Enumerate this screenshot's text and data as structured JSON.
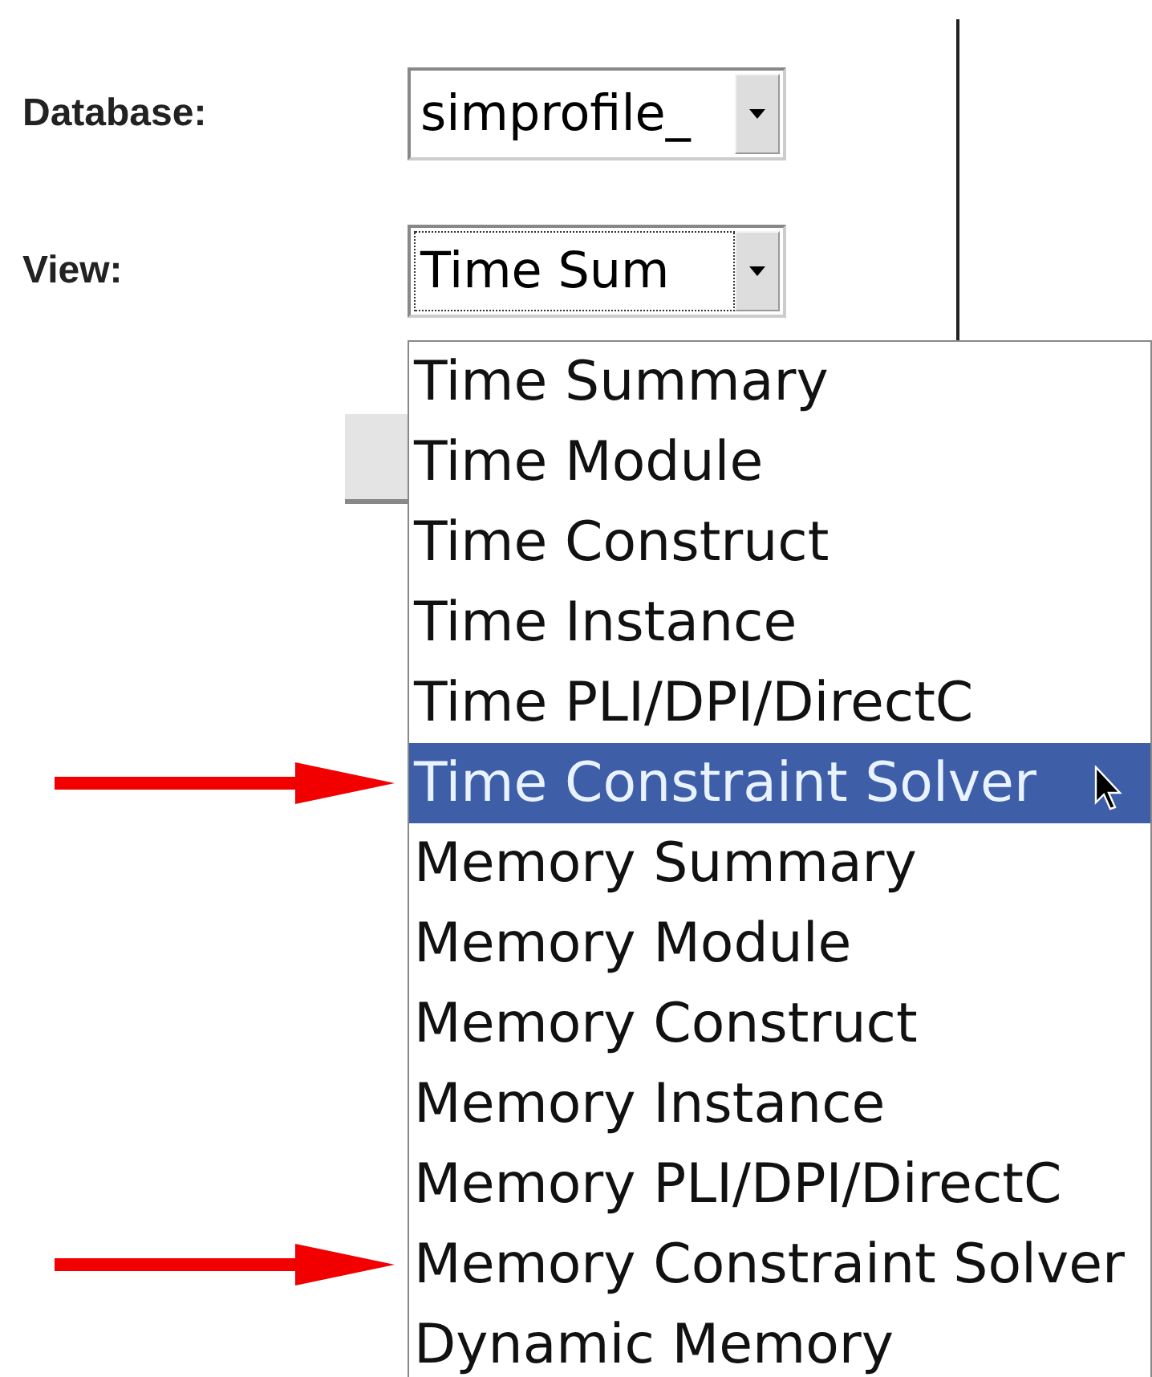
{
  "form": {
    "database_label": "Database:",
    "database_value": "simprofile_",
    "view_label": "View:",
    "view_value": "Time Sum"
  },
  "view_options": [
    {
      "label": "Time Summary",
      "selected": false,
      "annotated": false
    },
    {
      "label": "Time Module",
      "selected": false,
      "annotated": false
    },
    {
      "label": "Time Construct",
      "selected": false,
      "annotated": false
    },
    {
      "label": "Time Instance",
      "selected": false,
      "annotated": false
    },
    {
      "label": "Time PLI/DPI/DirectC",
      "selected": false,
      "annotated": false
    },
    {
      "label": "Time Constraint Solver",
      "selected": true,
      "annotated": true
    },
    {
      "label": "Memory Summary",
      "selected": false,
      "annotated": false
    },
    {
      "label": "Memory Module",
      "selected": false,
      "annotated": false
    },
    {
      "label": "Memory Construct",
      "selected": false,
      "annotated": false
    },
    {
      "label": "Memory Instance",
      "selected": false,
      "annotated": false
    },
    {
      "label": "Memory PLI/DPI/DirectC",
      "selected": false,
      "annotated": false
    },
    {
      "label": "Memory Constraint Solver",
      "selected": false,
      "annotated": true
    },
    {
      "label": "Dynamic Memory",
      "selected": false,
      "annotated": false
    }
  ]
}
